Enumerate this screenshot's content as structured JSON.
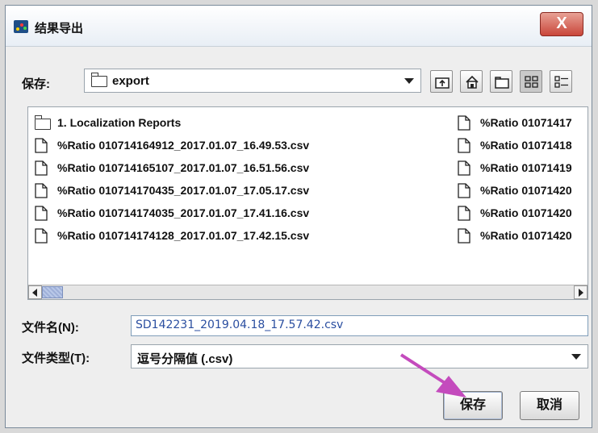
{
  "window": {
    "title": "结果导出",
    "close_glyph": "X"
  },
  "location": {
    "label": "保存:",
    "value": "export"
  },
  "toolbar": {
    "icons": [
      "up-one-level-icon",
      "home-icon",
      "new-folder-icon",
      "list-view-icon",
      "details-view-icon"
    ]
  },
  "files": {
    "column1": [
      {
        "name": "1. Localization Reports",
        "kind": "folder"
      },
      {
        "name": "%Ratio 010714164912_2017.01.07_16.49.53.csv",
        "kind": "file"
      },
      {
        "name": "%Ratio 010714165107_2017.01.07_16.51.56.csv",
        "kind": "file"
      },
      {
        "name": "%Ratio 010714170435_2017.01.07_17.05.17.csv",
        "kind": "file"
      },
      {
        "name": "%Ratio 010714174035_2017.01.07_17.41.16.csv",
        "kind": "file"
      },
      {
        "name": "%Ratio 010714174128_2017.01.07_17.42.15.csv",
        "kind": "file"
      }
    ],
    "column2": [
      {
        "name": "%Ratio 01071417",
        "kind": "file"
      },
      {
        "name": "%Ratio 01071418",
        "kind": "file"
      },
      {
        "name": "%Ratio 01071419",
        "kind": "file"
      },
      {
        "name": "%Ratio 01071420",
        "kind": "file"
      },
      {
        "name": "%Ratio 01071420",
        "kind": "file"
      },
      {
        "name": "%Ratio 01071420",
        "kind": "file"
      }
    ]
  },
  "filename": {
    "label": "文件名(N):",
    "value": "SD142231_2019.04.18_17.57.42.csv"
  },
  "filetype": {
    "label": "文件类型(T):",
    "value": "逗号分隔值 (.csv)"
  },
  "buttons": {
    "save": "保存",
    "cancel": "取消"
  },
  "colors": {
    "annotation_arrow": "#c44bbd",
    "close_button": "#c9463a",
    "app_icon": "#1f4f87"
  }
}
